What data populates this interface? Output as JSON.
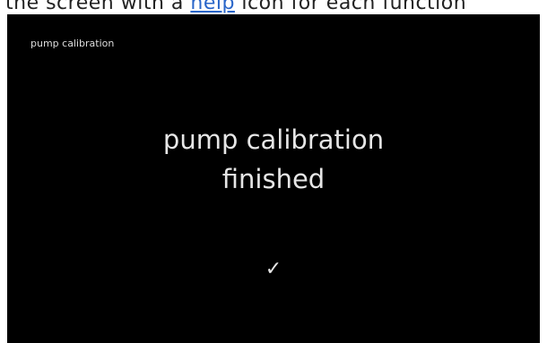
{
  "top_strip": {
    "before": "the screen with a ",
    "link": "help",
    "after": " icon for each function"
  },
  "screen": {
    "title": "pump calibration",
    "message_line1": "pump calibration",
    "message_line2": "finished",
    "check_icon": "check-icon",
    "check_glyph": "✓"
  },
  "colors": {
    "screen_background": "#000000",
    "text": "#e6e6e6",
    "link": "#2a66c9"
  }
}
